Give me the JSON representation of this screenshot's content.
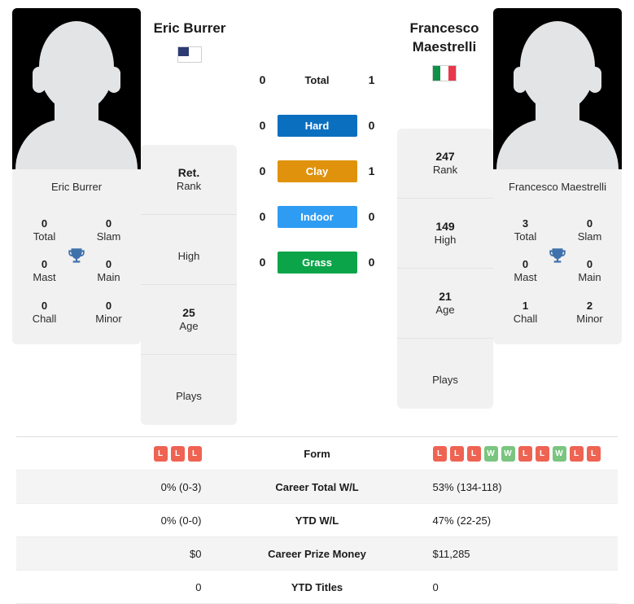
{
  "players": {
    "left": {
      "name": "Eric Burrer",
      "caption": "Eric Burrer",
      "flag": "us-flag-icon",
      "titles": {
        "total_val": "0",
        "total_lab": "Total",
        "slam_val": "0",
        "slam_lab": "Slam",
        "mast_val": "0",
        "mast_lab": "Mast",
        "main_val": "0",
        "main_lab": "Main",
        "chall_val": "0",
        "chall_lab": "Chall",
        "minor_val": "0",
        "minor_lab": "Minor"
      },
      "info": {
        "rank_val": "Ret.",
        "rank_lab": "Rank",
        "high_val": "",
        "high_lab": "High",
        "age_val": "25",
        "age_lab": "Age",
        "plays_val": "",
        "plays_lab": "Plays"
      }
    },
    "right": {
      "name": "Francesco Maestrelli",
      "caption": "Francesco Maestrelli",
      "flag": "it-flag-icon",
      "titles": {
        "total_val": "3",
        "total_lab": "Total",
        "slam_val": "0",
        "slam_lab": "Slam",
        "mast_val": "0",
        "mast_lab": "Mast",
        "main_val": "0",
        "main_lab": "Main",
        "chall_val": "1",
        "chall_lab": "Chall",
        "minor_val": "2",
        "minor_lab": "Minor"
      },
      "info": {
        "rank_val": "247",
        "rank_lab": "Rank",
        "high_val": "149",
        "high_lab": "High",
        "age_val": "21",
        "age_lab": "Age",
        "plays_val": "",
        "plays_lab": "Plays"
      }
    }
  },
  "h2h": {
    "rows": [
      {
        "left": "0",
        "label": "Total",
        "right": "1",
        "color": ""
      },
      {
        "left": "0",
        "label": "Hard",
        "right": "0",
        "color": "#0b6fc0"
      },
      {
        "left": "0",
        "label": "Clay",
        "right": "1",
        "color": "#e0920c"
      },
      {
        "left": "0",
        "label": "Indoor",
        "right": "0",
        "color": "#2f9cf4"
      },
      {
        "left": "0",
        "label": "Grass",
        "right": "0",
        "color": "#0ba449"
      }
    ]
  },
  "table": {
    "colors": {
      "win": "#7ac57f",
      "loss": "#ee6352"
    },
    "rows": [
      {
        "label": "Form",
        "type": "form",
        "left_form": [
          "L",
          "L",
          "L"
        ],
        "right_form": [
          "L",
          "L",
          "L",
          "W",
          "W",
          "L",
          "L",
          "W",
          "L",
          "L"
        ],
        "left": "",
        "right": ""
      },
      {
        "label": "Career Total W/L",
        "type": "text",
        "left": "0% (0-3)",
        "right": "53% (134-118)"
      },
      {
        "label": "YTD W/L",
        "type": "text",
        "left": "0% (0-0)",
        "right": "47% (22-25)"
      },
      {
        "label": "Career Prize Money",
        "type": "text",
        "left": "$0",
        "right": "$11,285"
      },
      {
        "label": "YTD Titles",
        "type": "text",
        "left": "0",
        "right": "0"
      }
    ]
  },
  "icons": {
    "trophy": "trophy-icon",
    "avatar": "avatar-placeholder-icon"
  }
}
